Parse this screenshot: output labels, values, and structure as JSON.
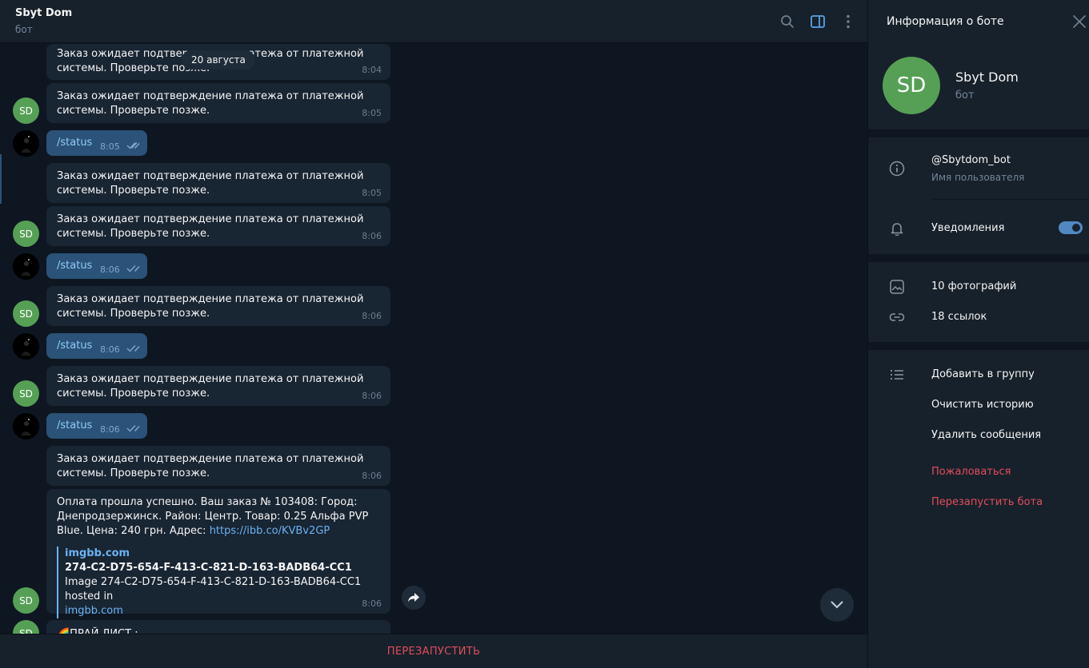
{
  "header": {
    "title": "Sbyt Dom",
    "subtitle": "бот"
  },
  "chat": {
    "date": "20 августа",
    "bot_initials": "SD",
    "messages": [
      {
        "text": "Заказ ожидает подтверждение платежа от платежной системы. Проверьте позже.",
        "time": "8:04"
      },
      {
        "text": "Заказ ожидает подтверждение платежа от платежной системы. Проверьте позже.",
        "time": "8:05"
      },
      {
        "text": "/status",
        "time": "8:05"
      },
      {
        "text": "Заказ ожидает подтверждение платежа от платежной системы. Проверьте позже.",
        "time": "8:05"
      },
      {
        "text": "Заказ ожидает подтверждение платежа от платежной системы. Проверьте позже.",
        "time": "8:06"
      },
      {
        "text": "/status",
        "time": "8:06"
      },
      {
        "text": "Заказ ожидает подтверждение платежа от платежной системы. Проверьте позже.",
        "time": "8:06"
      },
      {
        "text": "/status",
        "time": "8:06"
      },
      {
        "text": "Заказ ожидает подтверждение платежа от платежной системы. Проверьте позже.",
        "time": "8:06"
      },
      {
        "text": "/status",
        "time": "8:06"
      },
      {
        "text": "Заказ ожидает подтверждение платежа от платежной системы. Проверьте позже.",
        "time": "8:06"
      }
    ],
    "payment": {
      "text": "Оплата прошла успешно. Ваш заказ № 103408: Город: Днепродзержинск. Район: Центр. Товар: 0.25 Альфа PVP Blue. Цена: 240 грн. Адрес: ",
      "link": "https://ibb.co/KVBv2GP",
      "preview_site": "imgbb.com",
      "preview_title": "274-C2-D75-654-F-413-C-821-D-163-BADB64-CC1",
      "preview_desc": "Image 274-C2-D75-654-F-413-C-821-D-163-BADB64-CC1 hosted in",
      "preview_desc_link": "imgbb.com",
      "time": "8:06"
    },
    "last_partial": "🌈ПРАЙ ЛИСТ :"
  },
  "footer": {
    "restart_label": "ПЕРЕЗАПУСТИТЬ"
  },
  "panel": {
    "title": "Информация о боте",
    "initials": "SD",
    "name": "Sbyt Dom",
    "subtitle": "бот",
    "username": "@Sbytdom_bot",
    "username_label": "Имя пользователя",
    "notifications_label": "Уведомления",
    "notifications_on": true,
    "photos": "10 фотографий",
    "links": "18 ссылок",
    "add_to_group": "Добавить в группу",
    "clear_history": "Очистить историю",
    "delete_messages": "Удалить сообщения",
    "report": "Пожаловаться",
    "restart_bot": "Перезапустить бота"
  },
  "colors": {
    "accent": "#5288c1",
    "danger": "#e14d5a",
    "bot_avatar": "#56a055"
  }
}
